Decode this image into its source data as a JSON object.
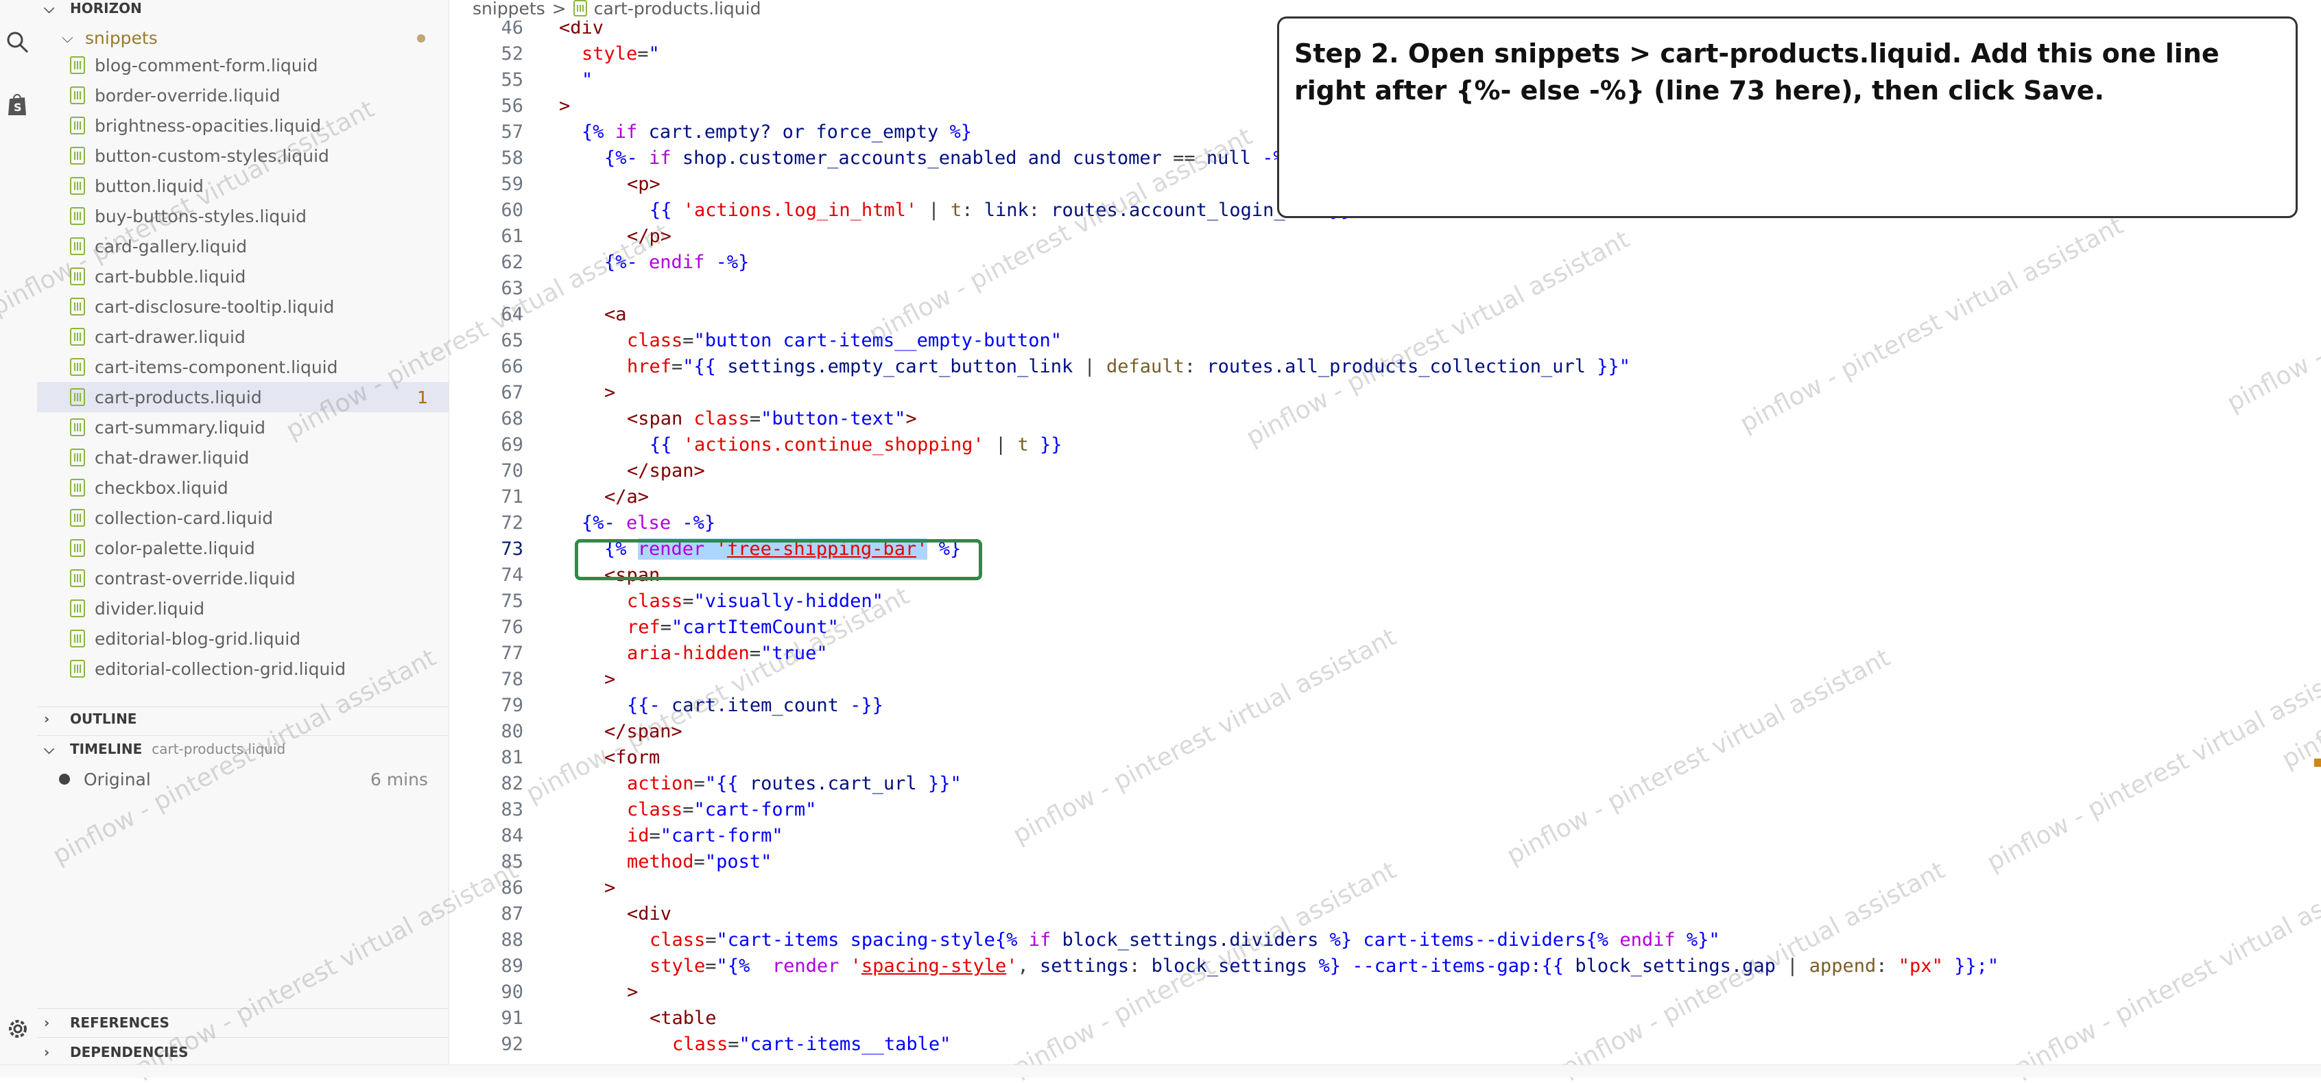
{
  "explorer": {
    "root": "HORIZON",
    "folder": "snippets",
    "files": [
      {
        "name": "blog-comment-form.liquid"
      },
      {
        "name": "border-override.liquid"
      },
      {
        "name": "brightness-opacities.liquid"
      },
      {
        "name": "button-custom-styles.liquid"
      },
      {
        "name": "button.liquid"
      },
      {
        "name": "buy-buttons-styles.liquid"
      },
      {
        "name": "card-gallery.liquid"
      },
      {
        "name": "cart-bubble.liquid"
      },
      {
        "name": "cart-disclosure-tooltip.liquid"
      },
      {
        "name": "cart-drawer.liquid"
      },
      {
        "name": "cart-items-component.liquid"
      },
      {
        "name": "cart-products.liquid",
        "badge": "1",
        "active": true
      },
      {
        "name": "cart-summary.liquid"
      },
      {
        "name": "chat-drawer.liquid"
      },
      {
        "name": "checkbox.liquid"
      },
      {
        "name": "collection-card.liquid"
      },
      {
        "name": "color-palette.liquid"
      },
      {
        "name": "contrast-override.liquid"
      },
      {
        "name": "divider.liquid"
      },
      {
        "name": "editorial-blog-grid.liquid"
      },
      {
        "name": "editorial-collection-grid.liquid"
      }
    ],
    "outline": "OUTLINE",
    "timeline": {
      "label": "TIMELINE",
      "file": "cart-products.liquid",
      "entry": "Original",
      "time": "6 mins"
    },
    "references": "REFERENCES",
    "dependencies": "DEPENDENCIES"
  },
  "breadcrumb": {
    "folder": "snippets",
    "separator": ">",
    "file": "cart-products.liquid"
  },
  "editor": {
    "current_line": "73",
    "lines": [
      {
        "n": "46",
        "indent": 0,
        "tokens": [
          [
            "t-tag",
            "<div"
          ]
        ]
      },
      {
        "n": "52",
        "indent": 1,
        "tokens": [
          [
            "t-attr",
            "style"
          ],
          [
            "t-plain",
            "="
          ],
          [
            "t-str",
            "\""
          ]
        ]
      },
      {
        "n": "55",
        "indent": 1,
        "tokens": [
          [
            "t-str",
            "\""
          ]
        ]
      },
      {
        "n": "56",
        "indent": 0,
        "tokens": [
          [
            "t-tag",
            ">"
          ]
        ]
      },
      {
        "n": "57",
        "indent": 1,
        "tokens": [
          [
            "t-kw",
            "{%"
          ],
          [
            "t-plain",
            " "
          ],
          [
            "t-ctl",
            "if"
          ],
          [
            "t-plain",
            " "
          ],
          [
            "t-var",
            "cart.empty?"
          ],
          [
            "t-plain",
            " "
          ],
          [
            "t-var",
            "or"
          ],
          [
            "t-plain",
            " "
          ],
          [
            "t-var",
            "force_empty"
          ],
          [
            "t-plain",
            " "
          ],
          [
            "t-kw",
            "%}"
          ]
        ]
      },
      {
        "n": "58",
        "indent": 2,
        "tokens": [
          [
            "t-kw",
            "{%-"
          ],
          [
            "t-plain",
            " "
          ],
          [
            "t-ctl",
            "if"
          ],
          [
            "t-plain",
            " "
          ],
          [
            "t-var",
            "shop.customer_accounts_enabled"
          ],
          [
            "t-plain",
            " "
          ],
          [
            "t-var",
            "and"
          ],
          [
            "t-plain",
            " "
          ],
          [
            "t-var",
            "customer"
          ],
          [
            "t-plain",
            " == "
          ],
          [
            "t-var",
            "null"
          ],
          [
            "t-plain",
            " "
          ],
          [
            "t-kw",
            "-%}"
          ]
        ]
      },
      {
        "n": "59",
        "indent": 3,
        "tokens": [
          [
            "t-tag",
            "<p>"
          ]
        ]
      },
      {
        "n": "60",
        "indent": 4,
        "tokens": [
          [
            "t-kw",
            "{{"
          ],
          [
            "t-plain",
            " "
          ],
          [
            "t-attr",
            "'actions.log_in_html'"
          ],
          [
            "t-plain",
            " | "
          ],
          [
            "t-fn",
            "t"
          ],
          [
            "t-plain",
            ": "
          ],
          [
            "t-var",
            "link"
          ],
          [
            "t-plain",
            ": "
          ],
          [
            "t-var",
            "routes.account_login_url"
          ],
          [
            "t-plain",
            " "
          ],
          [
            "t-kw",
            "}}"
          ]
        ]
      },
      {
        "n": "61",
        "indent": 3,
        "tokens": [
          [
            "t-tag",
            "</p>"
          ]
        ]
      },
      {
        "n": "62",
        "indent": 2,
        "tokens": [
          [
            "t-kw",
            "{%-"
          ],
          [
            "t-plain",
            " "
          ],
          [
            "t-ctl",
            "endif"
          ],
          [
            "t-plain",
            " "
          ],
          [
            "t-kw",
            "-%}"
          ]
        ]
      },
      {
        "n": "63",
        "indent": 0,
        "tokens": []
      },
      {
        "n": "64",
        "indent": 2,
        "tokens": [
          [
            "t-tag",
            "<a"
          ]
        ]
      },
      {
        "n": "65",
        "indent": 3,
        "tokens": [
          [
            "t-attr",
            "class"
          ],
          [
            "t-plain",
            "="
          ],
          [
            "t-str",
            "\"button cart-items__empty-button\""
          ]
        ]
      },
      {
        "n": "66",
        "indent": 3,
        "tokens": [
          [
            "t-attr",
            "href"
          ],
          [
            "t-plain",
            "="
          ],
          [
            "t-str",
            "\"{{ "
          ],
          [
            "t-var",
            "settings.empty_cart_button_link"
          ],
          [
            "t-plain",
            " | "
          ],
          [
            "t-fn",
            "default"
          ],
          [
            "t-plain",
            ": "
          ],
          [
            "t-var",
            "routes.all_products_collection_url"
          ],
          [
            "t-str",
            " }}\""
          ]
        ]
      },
      {
        "n": "67",
        "indent": 2,
        "tokens": [
          [
            "t-tag",
            ">"
          ]
        ]
      },
      {
        "n": "68",
        "indent": 3,
        "tokens": [
          [
            "t-tag",
            "<span"
          ],
          [
            "t-plain",
            " "
          ],
          [
            "t-attr",
            "class"
          ],
          [
            "t-plain",
            "="
          ],
          [
            "t-str",
            "\"button-text\""
          ],
          [
            "t-tag",
            ">"
          ]
        ]
      },
      {
        "n": "69",
        "indent": 4,
        "tokens": [
          [
            "t-kw",
            "{{"
          ],
          [
            "t-plain",
            " "
          ],
          [
            "t-attr",
            "'actions.continue_shopping'"
          ],
          [
            "t-plain",
            " | "
          ],
          [
            "t-fn",
            "t"
          ],
          [
            "t-plain",
            " "
          ],
          [
            "t-kw",
            "}}"
          ]
        ]
      },
      {
        "n": "70",
        "indent": 3,
        "tokens": [
          [
            "t-tag",
            "</span>"
          ]
        ]
      },
      {
        "n": "71",
        "indent": 2,
        "tokens": [
          [
            "t-tag",
            "</a>"
          ]
        ]
      },
      {
        "n": "72",
        "indent": 1,
        "tokens": [
          [
            "t-kw",
            "{%-"
          ],
          [
            "t-plain",
            " "
          ],
          [
            "t-ctl",
            "else"
          ],
          [
            "t-plain",
            " "
          ],
          [
            "t-kw",
            "-%}"
          ]
        ]
      },
      {
        "n": "73",
        "indent": 2,
        "tokens": [
          [
            "t-kw",
            "{%"
          ],
          [
            "t-plain",
            " "
          ],
          [
            "t-ctl hl",
            "render"
          ],
          [
            "t-plain hl",
            " "
          ],
          [
            "t-attr hl",
            "'"
          ],
          [
            "t-attr hl ul",
            "free-shipping-bar"
          ],
          [
            "t-attr hl",
            "'"
          ],
          [
            "t-plain",
            " "
          ],
          [
            "t-kw",
            "%}"
          ]
        ]
      },
      {
        "n": "74",
        "indent": 2,
        "tokens": [
          [
            "t-tag",
            "<span"
          ]
        ]
      },
      {
        "n": "75",
        "indent": 3,
        "tokens": [
          [
            "t-attr",
            "class"
          ],
          [
            "t-plain",
            "="
          ],
          [
            "t-str",
            "\"visually-hidden\""
          ]
        ]
      },
      {
        "n": "76",
        "indent": 3,
        "tokens": [
          [
            "t-attr",
            "ref"
          ],
          [
            "t-plain",
            "="
          ],
          [
            "t-str",
            "\"cartItemCount\""
          ]
        ]
      },
      {
        "n": "77",
        "indent": 3,
        "tokens": [
          [
            "t-attr",
            "aria-hidden"
          ],
          [
            "t-plain",
            "="
          ],
          [
            "t-str",
            "\"true\""
          ]
        ]
      },
      {
        "n": "78",
        "indent": 2,
        "tokens": [
          [
            "t-tag",
            ">"
          ]
        ]
      },
      {
        "n": "79",
        "indent": 3,
        "tokens": [
          [
            "t-kw",
            "{{-"
          ],
          [
            "t-plain",
            " "
          ],
          [
            "t-var",
            "cart.item_count"
          ],
          [
            "t-plain",
            " "
          ],
          [
            "t-kw",
            "-}}"
          ]
        ]
      },
      {
        "n": "80",
        "indent": 2,
        "tokens": [
          [
            "t-tag",
            "</span>"
          ]
        ]
      },
      {
        "n": "81",
        "indent": 2,
        "tokens": [
          [
            "t-tag",
            "<form"
          ]
        ]
      },
      {
        "n": "82",
        "indent": 3,
        "tokens": [
          [
            "t-attr",
            "action"
          ],
          [
            "t-plain",
            "="
          ],
          [
            "t-str",
            "\"{{ "
          ],
          [
            "t-var",
            "routes.cart_url"
          ],
          [
            "t-str",
            " }}\""
          ]
        ]
      },
      {
        "n": "83",
        "indent": 3,
        "tokens": [
          [
            "t-attr",
            "class"
          ],
          [
            "t-plain",
            "="
          ],
          [
            "t-str",
            "\"cart-form\""
          ]
        ]
      },
      {
        "n": "84",
        "indent": 3,
        "tokens": [
          [
            "t-attr",
            "id"
          ],
          [
            "t-plain",
            "="
          ],
          [
            "t-str",
            "\"cart-form\""
          ]
        ]
      },
      {
        "n": "85",
        "indent": 3,
        "tokens": [
          [
            "t-attr",
            "method"
          ],
          [
            "t-plain",
            "="
          ],
          [
            "t-str",
            "\"post\""
          ]
        ]
      },
      {
        "n": "86",
        "indent": 2,
        "tokens": [
          [
            "t-tag",
            ">"
          ]
        ]
      },
      {
        "n": "87",
        "indent": 3,
        "tokens": [
          [
            "t-tag",
            "<div"
          ]
        ]
      },
      {
        "n": "88",
        "indent": 4,
        "tokens": [
          [
            "t-attr",
            "class"
          ],
          [
            "t-plain",
            "="
          ],
          [
            "t-str",
            "\"cart-items spacing-style"
          ],
          [
            "t-kw",
            "{%"
          ],
          [
            "t-plain",
            " "
          ],
          [
            "t-ctl",
            "if"
          ],
          [
            "t-plain",
            " "
          ],
          [
            "t-var",
            "block_settings.dividers"
          ],
          [
            "t-plain",
            " "
          ],
          [
            "t-kw",
            "%}"
          ],
          [
            "t-str",
            " cart-items--dividers"
          ],
          [
            "t-kw",
            "{%"
          ],
          [
            "t-plain",
            " "
          ],
          [
            "t-ctl",
            "endif"
          ],
          [
            "t-plain",
            " "
          ],
          [
            "t-kw",
            "%}"
          ],
          [
            "t-str",
            "\""
          ]
        ]
      },
      {
        "n": "89",
        "indent": 4,
        "tokens": [
          [
            "t-attr",
            "style"
          ],
          [
            "t-plain",
            "="
          ],
          [
            "t-str",
            "\""
          ],
          [
            "t-kw",
            "{%"
          ],
          [
            "t-plain",
            "  "
          ],
          [
            "t-ctl",
            "render"
          ],
          [
            "t-plain",
            " "
          ],
          [
            "t-attr",
            "'"
          ],
          [
            "t-attr ul",
            "spacing-style"
          ],
          [
            "t-attr",
            "'"
          ],
          [
            "t-plain",
            ", "
          ],
          [
            "t-var",
            "settings"
          ],
          [
            "t-plain",
            ": "
          ],
          [
            "t-var",
            "block_settings"
          ],
          [
            "t-plain",
            " "
          ],
          [
            "t-kw",
            "%}"
          ],
          [
            "t-str",
            " --cart-items-gap:"
          ],
          [
            "t-kw",
            "{{"
          ],
          [
            "t-plain",
            " "
          ],
          [
            "t-var",
            "block_settings.gap"
          ],
          [
            "t-plain",
            " | "
          ],
          [
            "t-fn",
            "append"
          ],
          [
            "t-plain",
            ": "
          ],
          [
            "t-attr",
            "\"px\""
          ],
          [
            "t-plain",
            " "
          ],
          [
            "t-kw",
            "}}"
          ],
          [
            "t-str",
            ";\""
          ]
        ]
      },
      {
        "n": "90",
        "indent": 3,
        "tokens": [
          [
            "t-tag",
            ">"
          ]
        ]
      },
      {
        "n": "91",
        "indent": 4,
        "tokens": [
          [
            "t-tag",
            "<table"
          ]
        ]
      },
      {
        "n": "92",
        "indent": 5,
        "tokens": [
          [
            "t-attr",
            "class"
          ],
          [
            "t-plain",
            "="
          ],
          [
            "t-str",
            "\"cart-items__table\""
          ]
        ]
      }
    ]
  },
  "annotation": {
    "text": "Step 2. Open snippets > cart-products.liquid. Add this one line right after {%- else -%} (line 73 here), then click Save."
  },
  "watermark": "pinflow - pinterest virtual assistant",
  "colors": {
    "highlight_box": "#2e8b47",
    "active_file": "#e4e6f1",
    "liquid_icon": "#8ab63f"
  }
}
